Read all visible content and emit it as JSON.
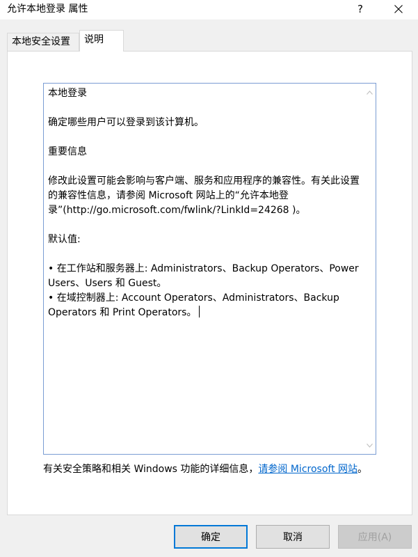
{
  "window": {
    "title": "允许本地登录 属性",
    "help_label": "?",
    "close_icon": "close-icon"
  },
  "tabs": [
    {
      "label": "本地安全设置",
      "active": false
    },
    {
      "label": "说明",
      "active": true
    }
  ],
  "explanation": {
    "heading": "本地登录",
    "summary": "确定哪些用户可以登录到该计算机。",
    "important_heading": "重要信息",
    "important_text": "修改此设置可能会影响与客户端、服务和应用程序的兼容性。有关此设置的兼容性信息，请参阅 Microsoft 网站上的“允许本地登录”(http://go.microsoft.com/fwlink/?LinkId=24268 )。",
    "default_heading": "默认值:",
    "default_workstations": "• 在工作站和服务器上: Administrators、Backup Operators、Power Users、Users 和 Guest。",
    "default_domain_controllers": "• 在域控制器上: Account Operators、Administrators、Backup Operators 和 Print Operators。"
  },
  "footer": {
    "text": "有关安全策略和相关 Windows 功能的详细信息，",
    "link_text": "请参阅 Microsoft 网站",
    "end": "。"
  },
  "buttons": {
    "ok": "确定",
    "cancel": "取消",
    "apply": "应用(A)"
  },
  "colors": {
    "accent": "#0078d7",
    "link": "#0066cc",
    "textbox_border": "#7a9cd3"
  }
}
